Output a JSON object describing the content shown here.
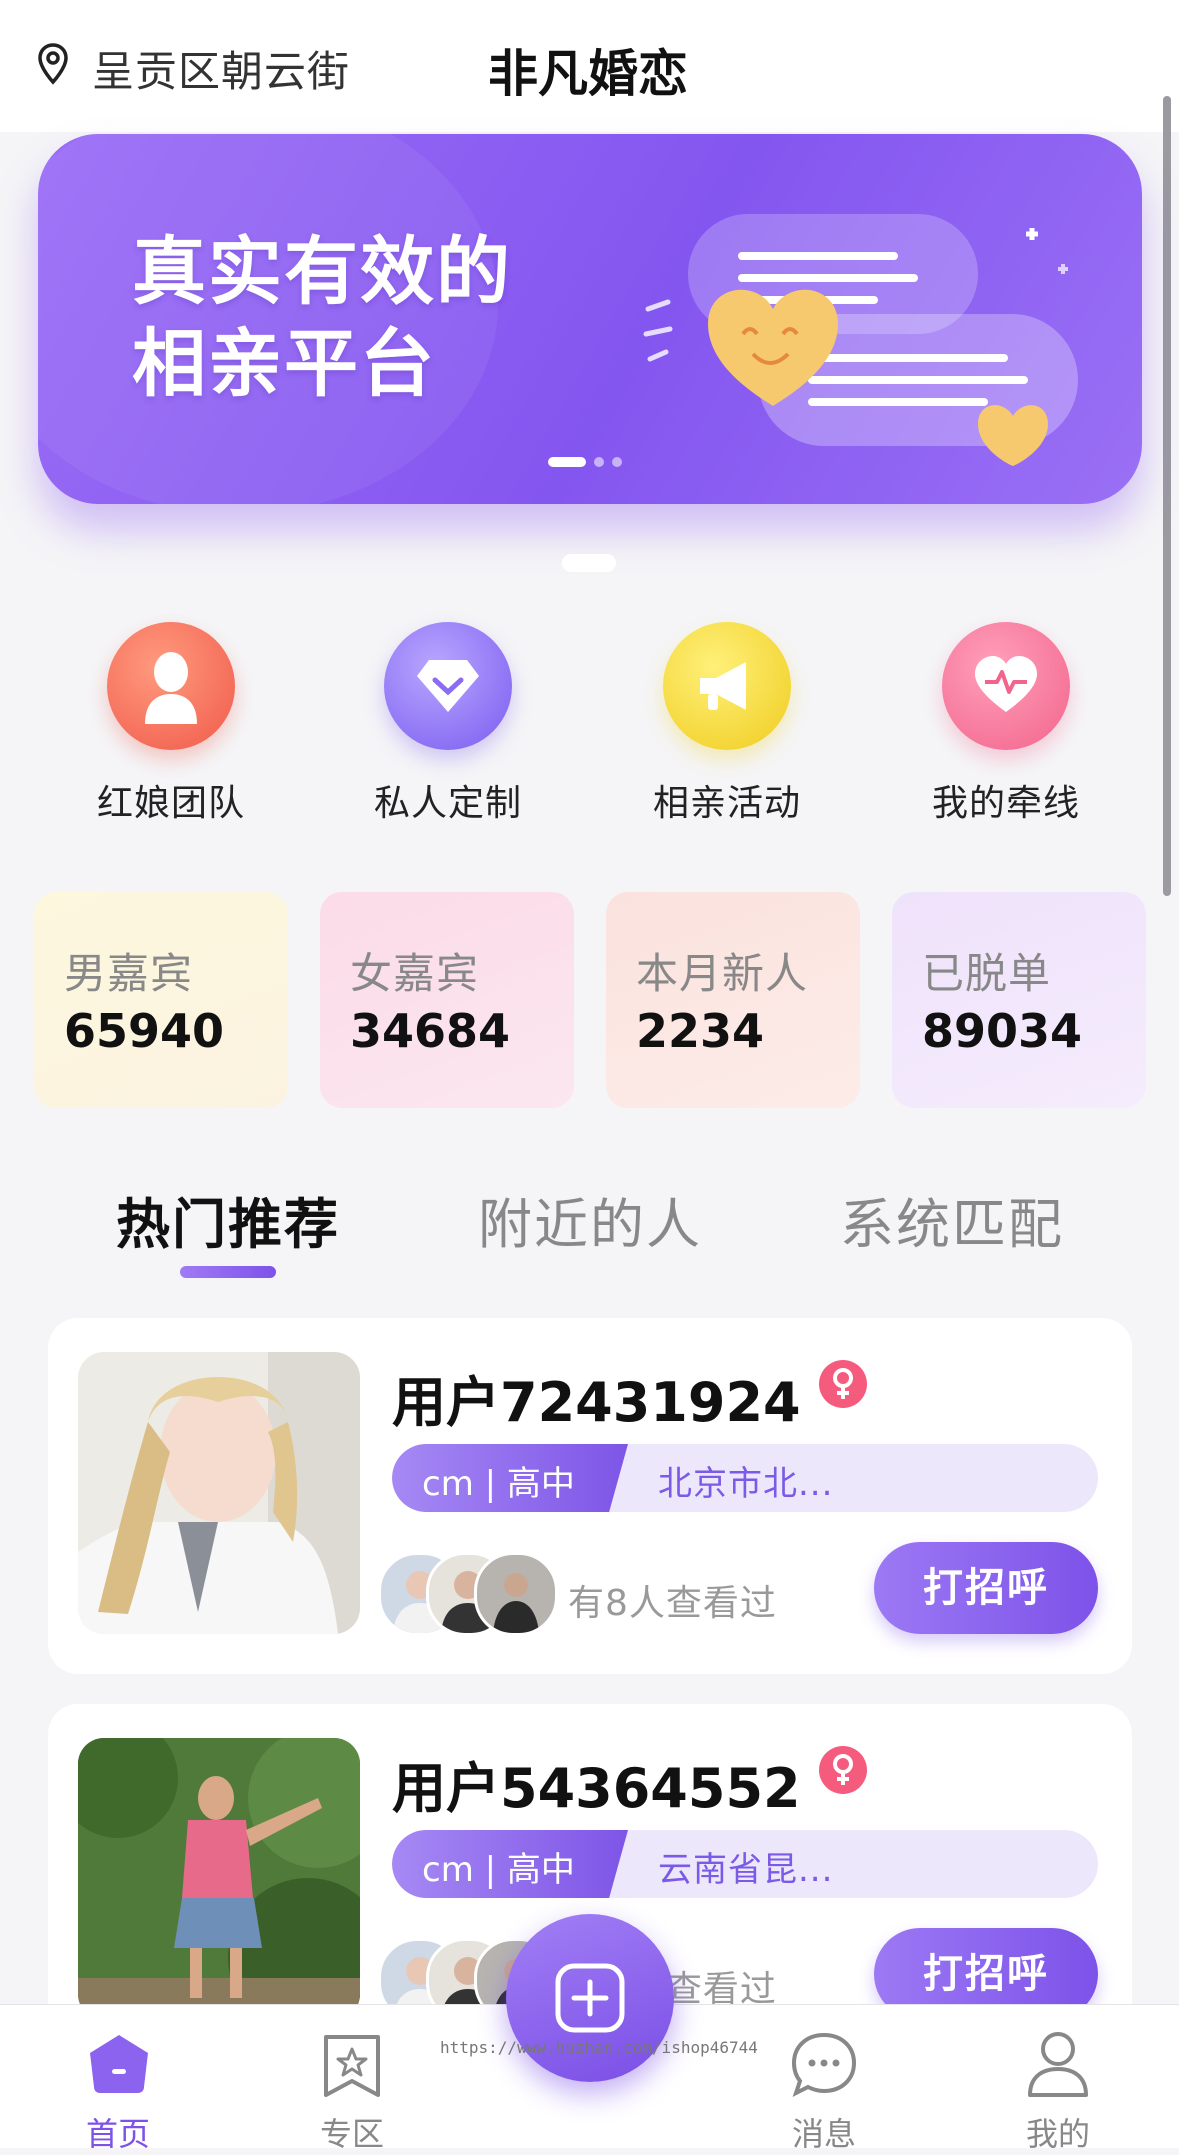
{
  "header": {
    "location": "呈贡区朝云街",
    "title": "非凡婚恋"
  },
  "banner": {
    "line1": "真实有效的",
    "line2": "相亲平台"
  },
  "quick_menu": [
    {
      "label": "红娘团队",
      "icon": "matchmaker-icon",
      "color": "#f4685a"
    },
    {
      "label": "私人定制",
      "icon": "diamond-icon",
      "color": "#8b6cf2"
    },
    {
      "label": "相亲活动",
      "icon": "megaphone-icon",
      "color": "#f2d535"
    },
    {
      "label": "我的牵线",
      "icon": "heart-pulse-icon",
      "color": "#f27598"
    }
  ],
  "stats": [
    {
      "label": "男嘉宾",
      "value": "65940"
    },
    {
      "label": "女嘉宾",
      "value": "34684"
    },
    {
      "label": "本月新人",
      "value": "2234"
    },
    {
      "label": "已脱单",
      "value": "89034"
    }
  ],
  "tabs": [
    {
      "label": "热门推荐",
      "active": true
    },
    {
      "label": "附近的人",
      "active": false
    },
    {
      "label": "系统匹配",
      "active": false
    }
  ],
  "cards": [
    {
      "name": "用户72431924",
      "gender": "female",
      "tag_main": "cm | 高中",
      "tag_location": "北京市北...",
      "viewed": "有8人查看过",
      "button": "打招呼"
    },
    {
      "name": "用户54364552",
      "gender": "female",
      "tag_main": "cm | 高中",
      "tag_location": "云南省昆...",
      "viewed": "有8人查看过",
      "button": "打招呼"
    }
  ],
  "bottom_nav": [
    {
      "label": "首页",
      "icon": "home-icon",
      "active": true
    },
    {
      "label": "专区",
      "icon": "star-bookmark-icon",
      "active": false
    },
    {
      "label": "消息",
      "icon": "chat-bubble-icon",
      "active": false
    },
    {
      "label": "我的",
      "icon": "person-icon",
      "active": false
    }
  ],
  "fab": {
    "icon": "plus-icon"
  },
  "watermark": "https://www.huzhan.com/ishop46744",
  "colors": {
    "accent": "#7d52e9",
    "female": "#f45b7d"
  }
}
